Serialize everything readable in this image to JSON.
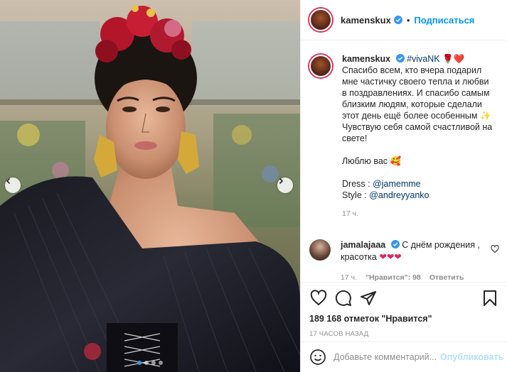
{
  "post": {
    "author": "kamenskux",
    "follow_dot": "•",
    "follow_label": "Подписаться",
    "slide_count": 4,
    "active_slide": 1
  },
  "caption": {
    "author": "kamenskux",
    "hashtag": "#vivaNK",
    "emoji_after_tag": "🌹❤️",
    "line1": "Спасибо всем, кто вчера подарил мне частичку своего тепла и любви в поздравлениях. И спасибо самым близким людям, которые сделали этот день ещё более особенным ✨ Чувствую себя самой счастливой на свете!",
    "line2": "Люблю вас 🥰",
    "dress_label": "Dress :",
    "dress_tag": "@jamemme",
    "style_label": "Style :",
    "style_tag": "@andreyyanko",
    "time": "17 ч."
  },
  "reply": {
    "author": "jamalajaaa",
    "text": "С днём рождения , красотка",
    "hearts": "❤❤❤",
    "time": "17 ч.",
    "likes": "\"Нравится\": 98",
    "reply_label": "Ответить"
  },
  "actions": {
    "likes_count": "189 168 отметок \"Нравится\"",
    "posted_ago": "17 часов назад"
  },
  "comment_box": {
    "placeholder": "Добавьте комментарий...",
    "publish_label": "Опубликовать"
  },
  "colors": {
    "link": "#0095f6",
    "muted": "#8e8e8e",
    "heart": "#e0245e",
    "publish_disabled": "#b2dffc"
  }
}
